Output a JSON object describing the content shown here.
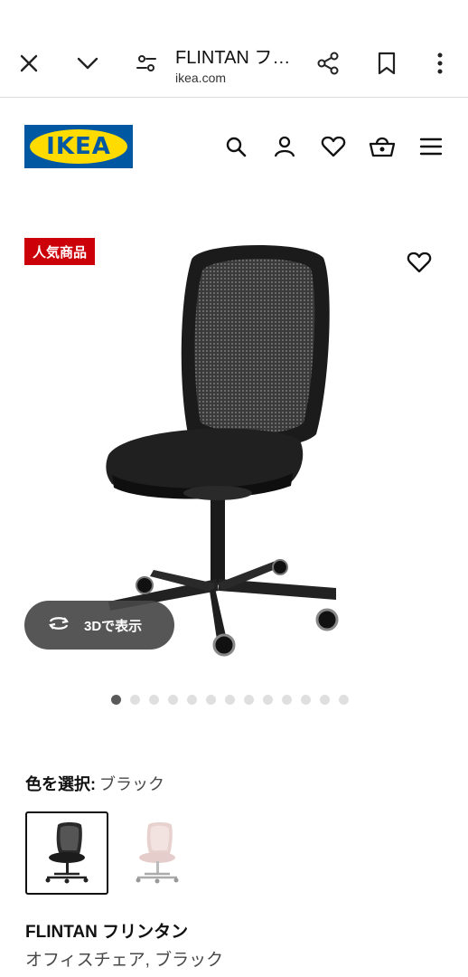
{
  "browser": {
    "title": "FLINTAN フ…",
    "host": "ikea.com",
    "icons": [
      "close-icon",
      "chevron-down-icon",
      "site-settings-icon",
      "share-icon",
      "bookmark-icon",
      "more-vert-icon"
    ]
  },
  "header": {
    "logo_text": "IKEA",
    "icons": [
      "search-icon",
      "account-icon",
      "heart-icon",
      "basket-icon",
      "menu-icon"
    ]
  },
  "product": {
    "badge": "人気商品",
    "view3d_label": "3Dで表示",
    "gallery": {
      "count": 13,
      "active": 1
    },
    "color_label": "色を選択:",
    "color_value": "ブラック",
    "variants": [
      "black",
      "pink"
    ],
    "name": "FLINTAN フリンタン",
    "description": "オフィスチェア, ブラック"
  },
  "colors": {
    "ikea_blue": "#0058a3",
    "ikea_yellow": "#ffdb00",
    "badge_red": "#cc0008"
  }
}
